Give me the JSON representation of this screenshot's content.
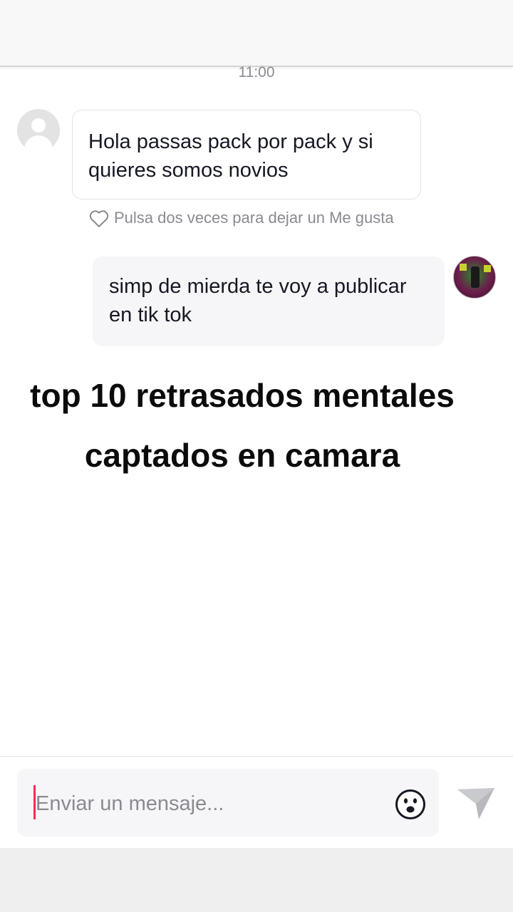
{
  "chat": {
    "timestamp": "11:00",
    "messages": [
      {
        "from": "other",
        "text": "Hola passas pack por pack y si quieres somos novios"
      },
      {
        "from": "me",
        "text": "simp de mierda te voy a publicar en tik tok"
      }
    ],
    "like_hint": "Pulsa dos veces para dejar un Me gusta"
  },
  "overlay": {
    "caption": "top 10 retrasados mentales captados en camara"
  },
  "composer": {
    "placeholder": "Enviar un mensaje...",
    "emoji_icon": "emoji-smile-icon",
    "send_icon": "send-arrow-icon"
  },
  "colors": {
    "accent_cursor": "#fe2c55",
    "bubble_outgoing": "#f6f5f7",
    "muted_text": "#8a8b91"
  }
}
